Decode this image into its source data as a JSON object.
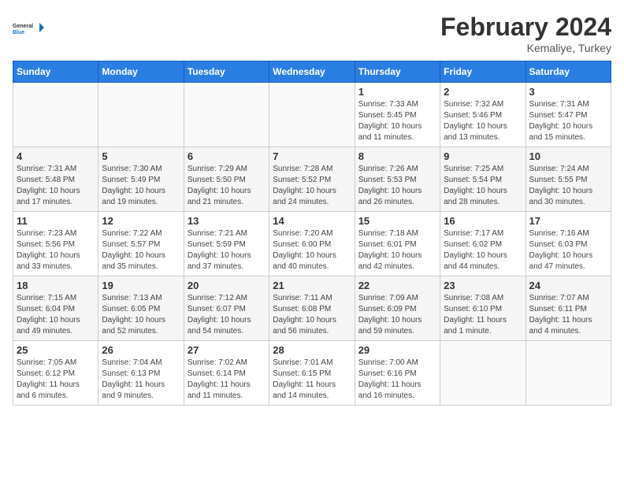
{
  "header": {
    "logo_general": "General",
    "logo_blue": "Blue",
    "month_year": "February 2024",
    "location": "Kemaliye, Turkey"
  },
  "weekdays": [
    "Sunday",
    "Monday",
    "Tuesday",
    "Wednesday",
    "Thursday",
    "Friday",
    "Saturday"
  ],
  "weeks": [
    [
      {
        "day": "",
        "info": ""
      },
      {
        "day": "",
        "info": ""
      },
      {
        "day": "",
        "info": ""
      },
      {
        "day": "",
        "info": ""
      },
      {
        "day": "1",
        "info": "Sunrise: 7:33 AM\nSunset: 5:45 PM\nDaylight: 10 hours\nand 11 minutes."
      },
      {
        "day": "2",
        "info": "Sunrise: 7:32 AM\nSunset: 5:46 PM\nDaylight: 10 hours\nand 13 minutes."
      },
      {
        "day": "3",
        "info": "Sunrise: 7:31 AM\nSunset: 5:47 PM\nDaylight: 10 hours\nand 15 minutes."
      }
    ],
    [
      {
        "day": "4",
        "info": "Sunrise: 7:31 AM\nSunset: 5:48 PM\nDaylight: 10 hours\nand 17 minutes."
      },
      {
        "day": "5",
        "info": "Sunrise: 7:30 AM\nSunset: 5:49 PM\nDaylight: 10 hours\nand 19 minutes."
      },
      {
        "day": "6",
        "info": "Sunrise: 7:29 AM\nSunset: 5:50 PM\nDaylight: 10 hours\nand 21 minutes."
      },
      {
        "day": "7",
        "info": "Sunrise: 7:28 AM\nSunset: 5:52 PM\nDaylight: 10 hours\nand 24 minutes."
      },
      {
        "day": "8",
        "info": "Sunrise: 7:26 AM\nSunset: 5:53 PM\nDaylight: 10 hours\nand 26 minutes."
      },
      {
        "day": "9",
        "info": "Sunrise: 7:25 AM\nSunset: 5:54 PM\nDaylight: 10 hours\nand 28 minutes."
      },
      {
        "day": "10",
        "info": "Sunrise: 7:24 AM\nSunset: 5:55 PM\nDaylight: 10 hours\nand 30 minutes."
      }
    ],
    [
      {
        "day": "11",
        "info": "Sunrise: 7:23 AM\nSunset: 5:56 PM\nDaylight: 10 hours\nand 33 minutes."
      },
      {
        "day": "12",
        "info": "Sunrise: 7:22 AM\nSunset: 5:57 PM\nDaylight: 10 hours\nand 35 minutes."
      },
      {
        "day": "13",
        "info": "Sunrise: 7:21 AM\nSunset: 5:59 PM\nDaylight: 10 hours\nand 37 minutes."
      },
      {
        "day": "14",
        "info": "Sunrise: 7:20 AM\nSunset: 6:00 PM\nDaylight: 10 hours\nand 40 minutes."
      },
      {
        "day": "15",
        "info": "Sunrise: 7:18 AM\nSunset: 6:01 PM\nDaylight: 10 hours\nand 42 minutes."
      },
      {
        "day": "16",
        "info": "Sunrise: 7:17 AM\nSunset: 6:02 PM\nDaylight: 10 hours\nand 44 minutes."
      },
      {
        "day": "17",
        "info": "Sunrise: 7:16 AM\nSunset: 6:03 PM\nDaylight: 10 hours\nand 47 minutes."
      }
    ],
    [
      {
        "day": "18",
        "info": "Sunrise: 7:15 AM\nSunset: 6:04 PM\nDaylight: 10 hours\nand 49 minutes."
      },
      {
        "day": "19",
        "info": "Sunrise: 7:13 AM\nSunset: 6:05 PM\nDaylight: 10 hours\nand 52 minutes."
      },
      {
        "day": "20",
        "info": "Sunrise: 7:12 AM\nSunset: 6:07 PM\nDaylight: 10 hours\nand 54 minutes."
      },
      {
        "day": "21",
        "info": "Sunrise: 7:11 AM\nSunset: 6:08 PM\nDaylight: 10 hours\nand 56 minutes."
      },
      {
        "day": "22",
        "info": "Sunrise: 7:09 AM\nSunset: 6:09 PM\nDaylight: 10 hours\nand 59 minutes."
      },
      {
        "day": "23",
        "info": "Sunrise: 7:08 AM\nSunset: 6:10 PM\nDaylight: 11 hours\nand 1 minute."
      },
      {
        "day": "24",
        "info": "Sunrise: 7:07 AM\nSunset: 6:11 PM\nDaylight: 11 hours\nand 4 minutes."
      }
    ],
    [
      {
        "day": "25",
        "info": "Sunrise: 7:05 AM\nSunset: 6:12 PM\nDaylight: 11 hours\nand 6 minutes."
      },
      {
        "day": "26",
        "info": "Sunrise: 7:04 AM\nSunset: 6:13 PM\nDaylight: 11 hours\nand 9 minutes."
      },
      {
        "day": "27",
        "info": "Sunrise: 7:02 AM\nSunset: 6:14 PM\nDaylight: 11 hours\nand 11 minutes."
      },
      {
        "day": "28",
        "info": "Sunrise: 7:01 AM\nSunset: 6:15 PM\nDaylight: 11 hours\nand 14 minutes."
      },
      {
        "day": "29",
        "info": "Sunrise: 7:00 AM\nSunset: 6:16 PM\nDaylight: 11 hours\nand 16 minutes."
      },
      {
        "day": "",
        "info": ""
      },
      {
        "day": "",
        "info": ""
      }
    ]
  ]
}
